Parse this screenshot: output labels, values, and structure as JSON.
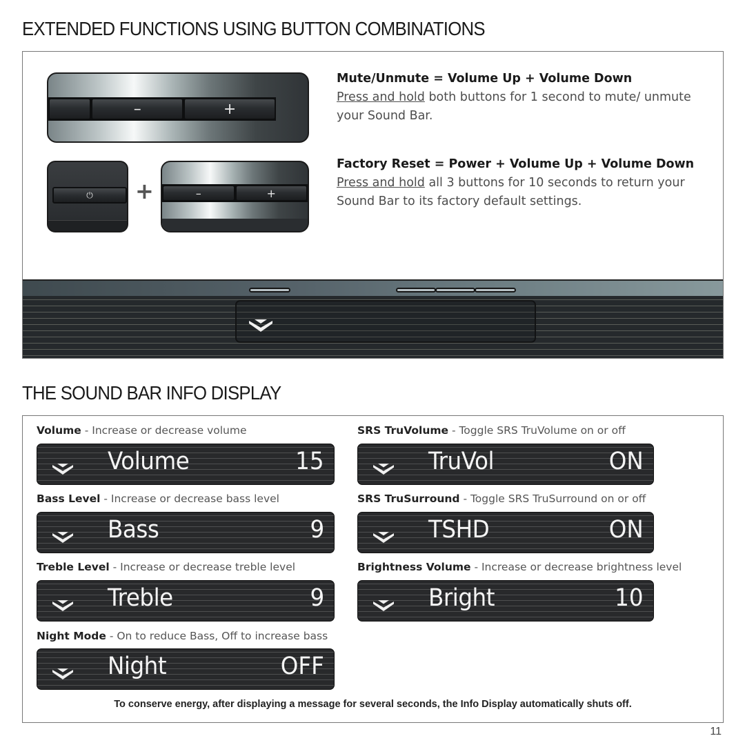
{
  "section1": {
    "title": "EXTENDED FUNCTIONS USING BUTTON COMBINATIONS",
    "mute_image": {
      "minus_label": "–",
      "plus_label": "+"
    },
    "reset_image": {
      "power_label": "⏻",
      "plus_sign": "+",
      "minus_label": "–",
      "plus_label": "+"
    },
    "mute": {
      "heading": "Mute/Unmute = Volume Up + Volume Down",
      "action": "Press and hold",
      "text": " both buttons for 1 second to mute/ unmute your Sound Bar."
    },
    "reset": {
      "heading": "Factory Reset = Power + Volume Up + Volume Down",
      "action": "Press and hold",
      "text": " all 3 buttons for 10 seconds to return your Sound Bar to its factory default settings."
    }
  },
  "section2": {
    "title": "THE SOUND BAR INFO DISPLAY",
    "displays": [
      {
        "name": "Volume",
        "desc": " - Increase or decrease volume",
        "label": "Volume",
        "value": "15"
      },
      {
        "name": "SRS TruVolume",
        "desc": " - Toggle SRS TruVolume on or off",
        "label": "TruVol",
        "value": "ON"
      },
      {
        "name": "Bass Level",
        "desc": " - Increase or decrease bass level",
        "label": "Bass",
        "value": "9"
      },
      {
        "name": "SRS TruSurround",
        "desc": " - Toggle SRS TruSurround on or off",
        "label": "TSHD",
        "value": "ON"
      },
      {
        "name": "Treble Level",
        "desc": " - Increase or decrease treble level",
        "label": "Treble",
        "value": "9"
      },
      {
        "name": "Brightness Volume",
        "desc": " - Increase or decrease brightness level",
        "label": "Bright",
        "value": "10"
      },
      {
        "name": "Night Mode",
        "desc": " - On to reduce Bass, Off to increase bass",
        "label": "Night",
        "value": "OFF"
      }
    ],
    "footnote": "To conserve energy, after displaying a message for several seconds, the Info Display automatically shuts off."
  },
  "page_number": "11",
  "colors": {
    "lcd_bg": "#28292b",
    "lcd_text": "#f4f4f4",
    "heading": "#1a1a1a",
    "body_text": "#4d4d4d"
  }
}
